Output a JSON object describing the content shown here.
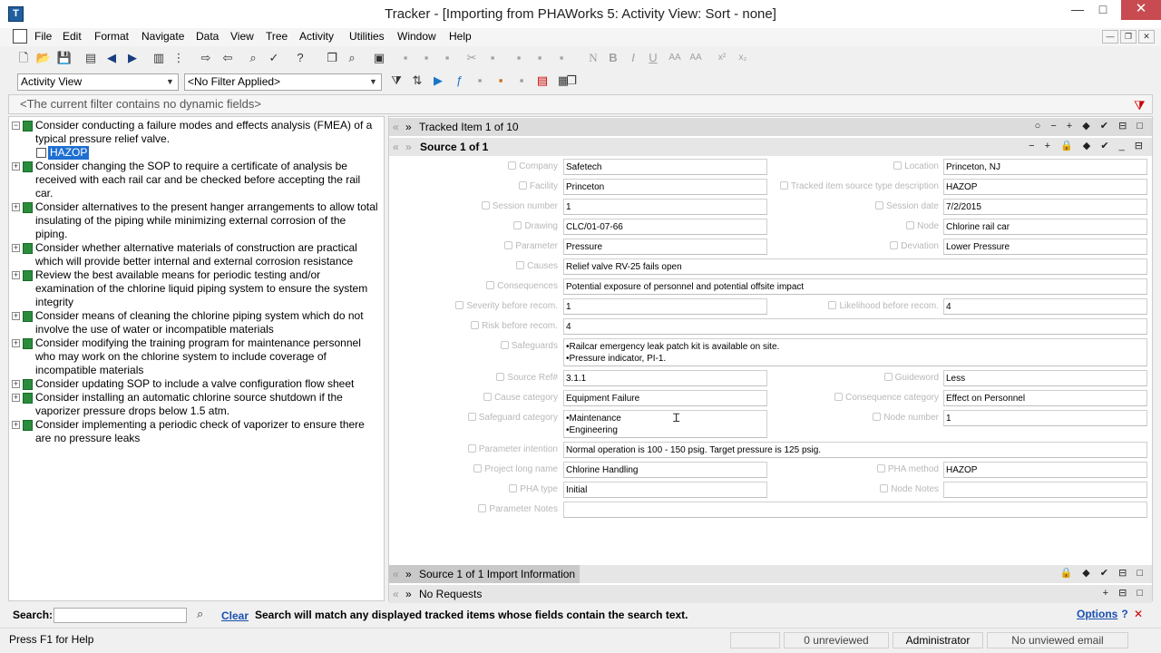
{
  "window": {
    "title": "Tracker - [Importing from PHAWorks 5: Activity View: Sort - none]",
    "min_glyph": "—",
    "max_glyph": "□",
    "close_glyph": "✕"
  },
  "menu": [
    "File",
    "Edit",
    "Format",
    "Navigate",
    "Data",
    "View",
    "Tree",
    "Activity",
    "Utilities",
    "Window",
    "Help"
  ],
  "toolbar2": {
    "view_select": "Activity View",
    "filter_select": "<No Filter Applied>"
  },
  "filter_bar": {
    "text": "<The current filter contains no dynamic fields>"
  },
  "tree": {
    "items": [
      {
        "text": "Consider conducting a failure modes and effects analysis (FMEA) of a typical pressure relief valve.",
        "expanded": true
      },
      {
        "text": "Consider changing the SOP to require a certificate of analysis be received with each rail car and be checked before accepting the rail car."
      },
      {
        "text": "Consider alternatives to the present hanger arrangements to allow total insulating of the piping while minimizing external corrosion of the piping."
      },
      {
        "text": "Consider whether alternative materials of construction are practical which will provide better internal and external corrosion resistance"
      },
      {
        "text": "Review the best available means for periodic testing and/or examination of the chlorine liquid piping system to ensure the system integrity"
      },
      {
        "text": "Consider means of cleaning the chlorine piping system which do not involve the use of water or incompatible materials"
      },
      {
        "text": "Consider modifying the training program for maintenance personnel who may work on the chlorine system to include coverage of incompatible materials"
      },
      {
        "text": "Consider updating SOP  to include a valve configuration flow sheet"
      },
      {
        "text": "Consider installing an automatic chlorine source shutdown if the vaporizer pressure drops below 1.5 atm."
      },
      {
        "text": "Consider implementing a periodic check of vaporizer to ensure there are no pressure leaks"
      }
    ],
    "selected_child": "HAZOP"
  },
  "panel": {
    "tracked_item": "Tracked Item 1 of 10",
    "source": "Source 1 of 1",
    "import_info": "Source 1 of 1 Import Information",
    "requests": "No Requests"
  },
  "fields": {
    "company": {
      "label": "Company",
      "value": "Safetech"
    },
    "location": {
      "label": "Location",
      "value": "Princeton, NJ"
    },
    "facility": {
      "label": "Facility",
      "value": "Princeton"
    },
    "source_type_desc": {
      "label": "Tracked item source type description",
      "value": "HAZOP"
    },
    "session_number": {
      "label": "Session number",
      "value": "1"
    },
    "session_date": {
      "label": "Session date",
      "value": "7/2/2015"
    },
    "drawing": {
      "label": "Drawing",
      "value": "CLC/01-07-66"
    },
    "node": {
      "label": "Node",
      "value": "Chlorine rail car"
    },
    "parameter": {
      "label": "Parameter",
      "value": "Pressure"
    },
    "deviation": {
      "label": "Deviation",
      "value": "Lower Pressure"
    },
    "causes": {
      "label": "Causes",
      "value": "Relief valve RV-25  fails open"
    },
    "consequences": {
      "label": "Consequences",
      "value": "Potential exposure of personnel and potential offsite impact"
    },
    "severity": {
      "label": "Severity before recom.",
      "value": "1"
    },
    "likelihood": {
      "label": "Likelihood before recom.",
      "value": "4"
    },
    "risk": {
      "label": "Risk before recom.",
      "value": "4"
    },
    "safeguards": {
      "label": "Safeguards",
      "line1": "•Railcar emergency leak patch kit is available on site.",
      "line2": "•Pressure indicator, PI-1."
    },
    "source_ref": {
      "label": "Source Ref#",
      "value": "3.1.1"
    },
    "guideword": {
      "label": "Guideword",
      "value": "Less"
    },
    "cause_category": {
      "label": "Cause category",
      "value": "Equipment Failure"
    },
    "consequence_category": {
      "label": "Consequence category",
      "value": "Effect on Personnel"
    },
    "safeguard_category": {
      "label": "Safeguard category",
      "line1": "•Maintenance",
      "line2": "•Engineering"
    },
    "node_number": {
      "label": "Node number",
      "value": "1"
    },
    "parameter_intention": {
      "label": "Parameter intention",
      "value": "Normal operation is 100 - 150 psig.  Target pressure is 125 psig."
    },
    "project_long_name": {
      "label": "Project long name",
      "value": "Chlorine Handling"
    },
    "pha_method": {
      "label": "PHA method",
      "value": "HAZOP"
    },
    "pha_type": {
      "label": "PHA type",
      "value": "Initial"
    },
    "node_notes": {
      "label": "Node Notes",
      "value": ""
    },
    "parameter_notes": {
      "label": "Parameter Notes",
      "value": ""
    }
  },
  "search": {
    "label": "Search:",
    "clear": "Clear",
    "hint": "Search will match any displayed tracked items whose fields contain the search text.",
    "options": "Options",
    "help": "?"
  },
  "status": {
    "help": "Press F1 for Help",
    "unreviewed": "0 unreviewed",
    "user": "Administrator",
    "email": "No unviewed email"
  }
}
